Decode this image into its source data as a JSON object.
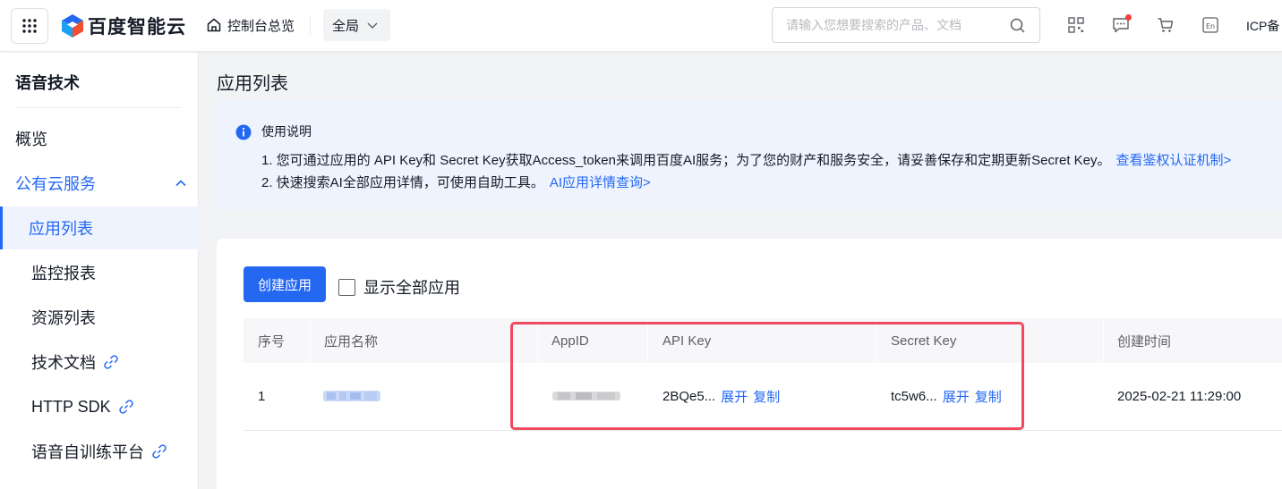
{
  "header": {
    "logo_text": "百度智能云",
    "home_label": "控制台总览",
    "region_label": "全局",
    "search_placeholder": "请输入您想要搜索的产品、文档",
    "icp_label": "ICP备"
  },
  "sidebar": {
    "title": "语音技术",
    "items": [
      {
        "label": "概览"
      },
      {
        "label": "公有云服务"
      },
      {
        "label": "应用列表"
      },
      {
        "label": "监控报表"
      },
      {
        "label": "资源列表"
      },
      {
        "label": "技术文档"
      },
      {
        "label": "HTTP SDK"
      },
      {
        "label": "语音自训练平台"
      }
    ]
  },
  "main": {
    "page_title": "应用列表",
    "notice": {
      "title": "使用说明",
      "line1": "1. 您可通过应用的 API Key和 Secret Key获取Access_token来调用百度AI服务；为了您的财产和服务安全，请妥善保存和定期更新Secret Key。",
      "line1_link": "查看鉴权认证机制>",
      "line2": "2. 快速搜索AI全部应用详情，可使用自助工具。",
      "line2_link": "AI应用详情查询>"
    },
    "create_button": "创建应用",
    "show_all_label": "显示全部应用",
    "table": {
      "columns": [
        "序号",
        "应用名称",
        "AppID",
        "API Key",
        "Secret Key",
        "创建时间"
      ],
      "rows": [
        {
          "index": "1",
          "api_key": "2BQe5...",
          "secret_key": "tc5w6...",
          "expand_label": "展开",
          "copy_label": "复制",
          "created": "2025-02-21 11:29:00"
        }
      ]
    }
  },
  "colors": {
    "brand_blue": "#2468f2",
    "highlight_red": "#ef4a5f",
    "notice_bg": "#eef3fe"
  }
}
